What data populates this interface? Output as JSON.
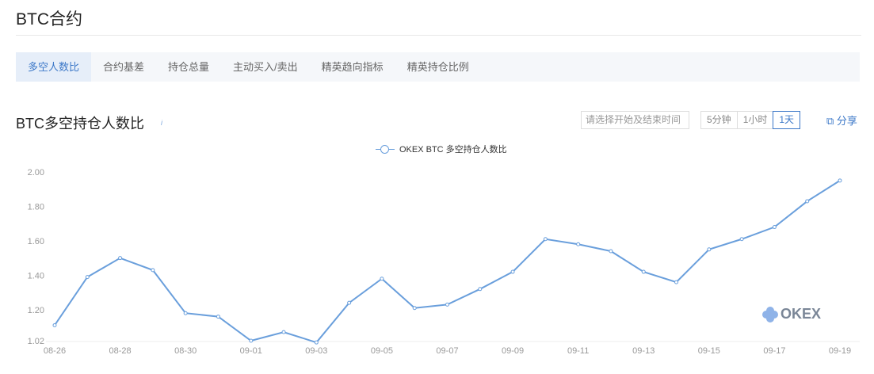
{
  "page_title": "BTC合约",
  "tabs": [
    "多空人数比",
    "合约基差",
    "持仓总量",
    "主动买入/卖出",
    "精英趋向指标",
    "精英持仓比例"
  ],
  "section_title": "BTC多空持仓人数比",
  "info_icon": "i",
  "date_placeholder": "请选择开始及结束时间",
  "intervals": [
    "5分钟",
    "1小时",
    "1天"
  ],
  "active_interval": "1天",
  "share_label": "分享",
  "watermark": "OKEX",
  "colors": {
    "line": "#6a9fdc",
    "accent": "#3c78c8"
  },
  "chart_data": {
    "type": "line",
    "title": "BTC多空持仓人数比",
    "legend": [
      "OKEX BTC 多空持仓人数比"
    ],
    "legend_position": "top-center",
    "x": [
      "08-26",
      "08-27",
      "08-28",
      "08-29",
      "08-30",
      "08-31",
      "09-01",
      "09-02",
      "09-03",
      "09-04",
      "09-05",
      "09-06",
      "09-07",
      "09-08",
      "09-09",
      "09-10",
      "09-11",
      "09-12",
      "09-13",
      "09-14",
      "09-15",
      "09-16",
      "09-17",
      "09-18",
      "09-19"
    ],
    "x_tick_labels": [
      "08-26",
      "08-28",
      "08-30",
      "09-01",
      "09-03",
      "09-05",
      "09-07",
      "09-09",
      "09-11",
      "09-13",
      "09-15",
      "09-17",
      "09-19"
    ],
    "series": [
      {
        "name": "OKEX BTC 多空持仓人数比",
        "values": [
          1.11,
          1.39,
          1.5,
          1.43,
          1.18,
          1.16,
          1.02,
          1.07,
          1.01,
          1.24,
          1.38,
          1.21,
          1.23,
          1.32,
          1.42,
          1.61,
          1.58,
          1.54,
          1.42,
          1.36,
          1.55,
          1.61,
          1.68,
          1.83,
          1.95
        ]
      }
    ],
    "y_tick_labels": [
      "1.02",
      "1.20",
      "1.40",
      "1.60",
      "1.80",
      "2.00"
    ],
    "y_ticks": [
      1.02,
      1.2,
      1.4,
      1.6,
      1.8,
      2.0
    ],
    "ylim": [
      1.02,
      2.0
    ],
    "grid": false
  }
}
